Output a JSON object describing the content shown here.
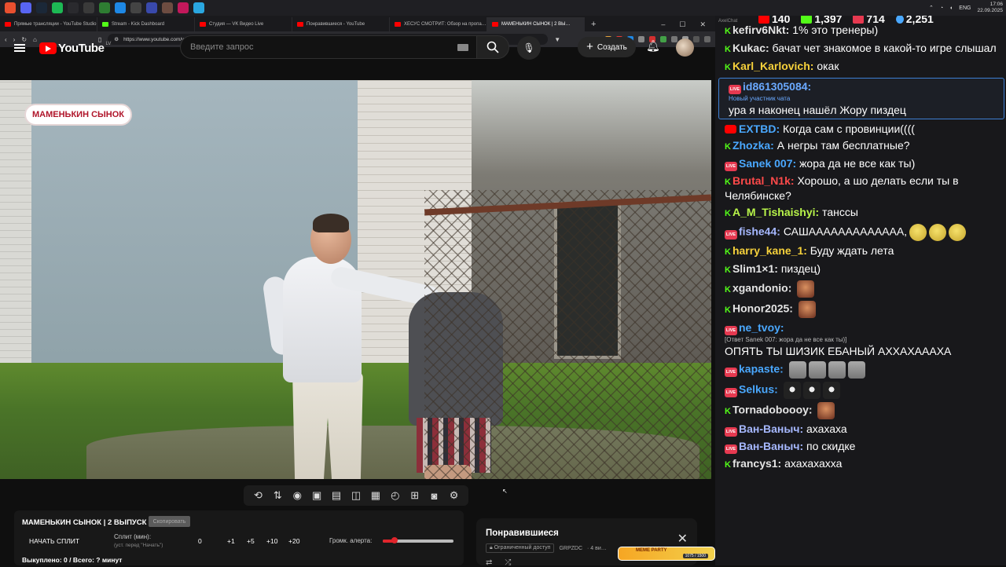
{
  "taskbar": {
    "time": "17:06",
    "date": "22.09.2025",
    "lang": "ENG"
  },
  "browser": {
    "tabs": [
      {
        "label": "Прямые трансляции - YouTube Studio",
        "color": "#ff0000"
      },
      {
        "label": "Stream - Kick Dashboard",
        "color": "#53fc18"
      },
      {
        "label": "Студия — VK Видео Live",
        "color": "#ff0000"
      },
      {
        "label": "Понравившиеся - YouTube",
        "color": "#ff0000"
      },
      {
        "label": "ХЕСУС СМОТРИТ: Обзор на пропа…",
        "color": "#ff0000"
      },
      {
        "label": "МАМЕНЬКИН СЫНОК | 2 ВЫ…",
        "color": "#ff0000"
      }
    ],
    "url": "https://www.youtube.com/watch?v=8FJOeJs3xDA&list=LL&index=3"
  },
  "youtube": {
    "logo_text": "YouTube",
    "region": "LV",
    "search_placeholder": "Введите запрос",
    "create_label": "Создать"
  },
  "video": {
    "badge": "МАМЕНЬКИН СЫНОК"
  },
  "toolbar_icons": [
    "repeat-icon",
    "sort-icon",
    "broadcast-icon",
    "camera-settings-icon",
    "clapper-icon",
    "picture-in-picture-icon",
    "captions-icon",
    "speed-icon",
    "frame-add-icon",
    "screenshot-icon",
    "settings-gear-icon"
  ],
  "split": {
    "title": "МАМЕНЬКИН СЫНОК | 2 ВЫПУСК",
    "copy_label": "Скопировать",
    "start_label": "НАЧАТЬ СПЛИТ",
    "split_min_label": "Сплит (мин):",
    "split_hint": "(уст. перед \"Начать\")",
    "value_zero": "0",
    "plus_buttons": [
      "+1",
      "+5",
      "+10",
      "+20"
    ],
    "volume_label": "Громк. алерта:",
    "volume_level": 0.17,
    "bought_label": "Выкуплено: 0 / Всего: ? минут"
  },
  "liked": {
    "title": "Понравившиеся",
    "access": "Ограниченный доступ",
    "channel": "GRPZDC",
    "count": "· 4 ви…"
  },
  "meme_party": {
    "label": "MEME PARTY",
    "count": "1075 / 1500"
  },
  "chat": {
    "app_name": "AxelChat",
    "stats": [
      {
        "platform": "youtube",
        "value": "140",
        "color": "#ff0000"
      },
      {
        "platform": "kick",
        "value": "1,397",
        "color": "#53fc18"
      },
      {
        "platform": "vk",
        "value": "714",
        "color": "#e63950"
      },
      {
        "platform": "viewers",
        "value": "2,251",
        "color": "#4aa8ff"
      }
    ],
    "messages": [
      {
        "platform": "kick",
        "user": "kefirv6Nkt:",
        "color": "#e4e4e4",
        "text": "1% это тренеры)"
      },
      {
        "platform": "kick",
        "user": "Kukac:",
        "color": "#e4e4e4",
        "text": "бачат чет знакомое в какой-то игре слышал"
      },
      {
        "platform": "kick",
        "user": "Karl_Karlovich:",
        "color": "#f6d13b",
        "text": "окак"
      },
      {
        "platform": "vk",
        "user": "id861305084:",
        "color": "#6aa9ff",
        "sub": "Новый участник чата",
        "text": "ура я наконец нашёл Жору пиздец",
        "highlight": true
      },
      {
        "platform": "yt",
        "user": "EXTBD:",
        "color": "#4aa8ff",
        "text": "Когда сам с провинции(((("
      },
      {
        "platform": "kick",
        "user": "Zhozka:",
        "color": "#4aa8ff",
        "text": "А негры там бесплатные?"
      },
      {
        "platform": "vk",
        "user": "Sanek 007:",
        "color": "#4aa8ff",
        "text": "жора да не все как ты)"
      },
      {
        "platform": "kick",
        "user": "Brutal_N1k:",
        "color": "#ff4a4a",
        "text": "Хорошо, а шо делать если ты в Челябинске?"
      },
      {
        "platform": "kick",
        "user": "A_M_Tishaishyi:",
        "color": "#b8f44a",
        "text": "танссы"
      },
      {
        "platform": "vk",
        "user": "fishe44:",
        "color": "#a6b8ff",
        "text": "САШААААААААААААА,",
        "emotes": [
          "blob",
          "blob",
          "blob"
        ]
      },
      {
        "platform": "kick",
        "user": "harry_kane_1:",
        "color": "#f6d13b",
        "text": "Буду ждать лета"
      },
      {
        "platform": "kick",
        "user": "Slim1×1:",
        "color": "#e4e4e4",
        "text": "пиздец)"
      },
      {
        "platform": "kick",
        "user": "xgandonio:",
        "color": "#e4e4e4",
        "text": "",
        "emotes": [
          "face"
        ]
      },
      {
        "platform": "kick",
        "user": "Honor2025:",
        "color": "#e4e4e4",
        "text": "",
        "emotes": [
          "face"
        ]
      },
      {
        "platform": "vk",
        "user": "ne_tvoy:",
        "color": "#4aa8ff",
        "reply": "[Ответ Sanek 007: жора да не все как ты)]",
        "text": "ОПЯТЬ ТЫ ШИЗИК ЕБАНЫЙ АХХАХАААХА"
      },
      {
        "platform": "vk",
        "user": "kapaste:",
        "color": "#4aa8ff",
        "text": "",
        "emotes": [
          "stone",
          "stone",
          "stone",
          "stone"
        ]
      },
      {
        "platform": "vk",
        "user": "Selkus:",
        "color": "#4aa8ff",
        "text": "",
        "emotes": [
          "cat",
          "cat",
          "cat"
        ]
      },
      {
        "platform": "kick",
        "user": "Tornadoboooy:",
        "color": "#e4e4e4",
        "text": "",
        "emotes": [
          "face"
        ]
      },
      {
        "platform": "vk",
        "user": "Ван-Ваныч:",
        "color": "#a6b8ff",
        "text": "ахахаха"
      },
      {
        "platform": "vk",
        "user": "Ван-Ваныч:",
        "color": "#a6b8ff",
        "text": "по скидке"
      },
      {
        "platform": "kick",
        "user": "francys1:",
        "color": "#e4e4e4",
        "text": "ахахахахха"
      }
    ]
  }
}
